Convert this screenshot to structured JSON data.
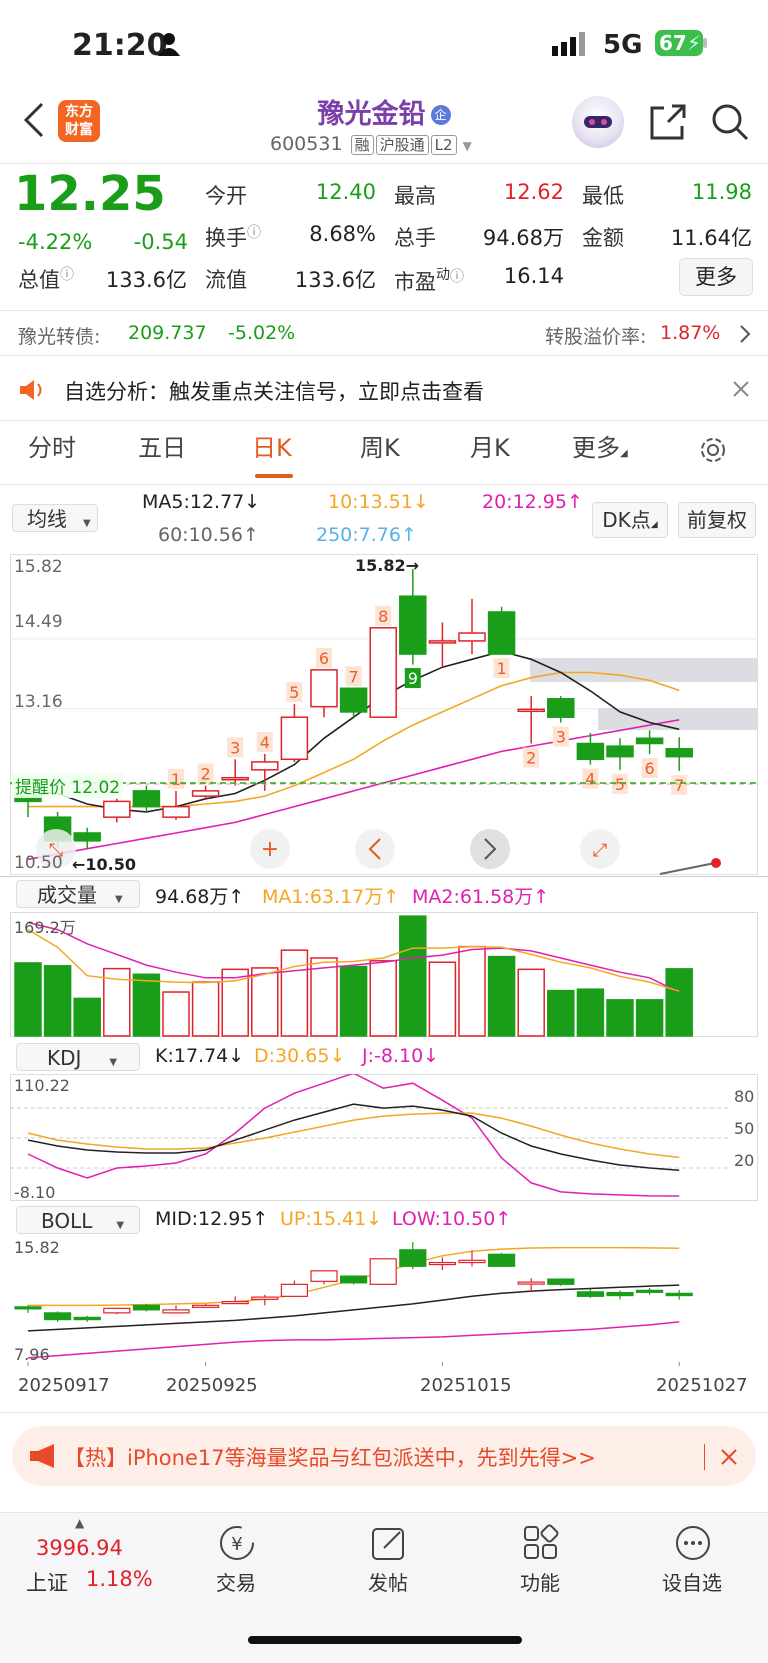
{
  "status": {
    "time": "21:20",
    "network": "5G",
    "battery": "67"
  },
  "header": {
    "back": "<",
    "logo_line1": "东方",
    "logo_line2": "财富",
    "title": "豫光金铅",
    "title_badge": "企",
    "code": "600531",
    "tags": [
      "融",
      "沪股通",
      "L2"
    ]
  },
  "quote": {
    "price": "12.25",
    "change_pct": "-4.22%",
    "change": "-0.54",
    "labels": {
      "open": "今开",
      "high": "最高",
      "low": "最低",
      "turnover": "换手",
      "volume": "总手",
      "amount": "金额",
      "mcap": "总值",
      "float": "流值",
      "pe": "市盈",
      "pe_sup": "动",
      "more": "更多"
    },
    "values": {
      "open": "12.40",
      "high": "12.62",
      "low": "11.98",
      "turnover": "8.68%",
      "volume": "94.68万",
      "amount": "11.64亿",
      "mcap": "133.6亿",
      "float": "133.6亿",
      "pe": "16.14"
    }
  },
  "bond": {
    "name": "豫光转债:",
    "price": "209.737",
    "change": "-5.02%",
    "premium_label": "转股溢价率:",
    "premium": "1.87%"
  },
  "notice": {
    "text": "自选分析：触发重点关注信号，立即点击查看"
  },
  "tabs": [
    "分时",
    "五日",
    "日K",
    "周K",
    "月K",
    "更多"
  ],
  "active_tab": "日K",
  "ma": {
    "selector": "均线",
    "ma5": "MA5:12.77",
    "ma10": "10:13.51",
    "ma20": "20:12.95",
    "ma60": "60:10.56",
    "ma250": "250:7.76",
    "dk": "DK点",
    "adjust": "前复权"
  },
  "kline": {
    "y_labels": [
      "15.82",
      "14.49",
      "13.16",
      "10.50"
    ],
    "high_label": "15.82",
    "low_label": "10.50",
    "alert_label": "提醒价 12.02",
    "nine_up": [
      "1",
      "2",
      "3",
      "4",
      "5",
      "6",
      "7",
      "8",
      "9"
    ],
    "nine_down": [
      "1",
      "2",
      "3",
      "4",
      "5",
      "6",
      "7"
    ]
  },
  "vol": {
    "selector": "成交量",
    "value": "94.68万",
    "ma1": "MA1:63.17万",
    "ma2": "MA2:61.58万",
    "y_top": "169.2万"
  },
  "kdj": {
    "selector": "KDJ",
    "k": "K:17.74",
    "d": "D:30.65",
    "j": "J:-8.10",
    "y_top": "110.22",
    "y_bottom": "-8.10",
    "levels": [
      "80",
      "50",
      "20"
    ]
  },
  "boll": {
    "selector": "BOLL",
    "mid": "MID:12.95",
    "up": "UP:15.41",
    "low": "LOW:10.50",
    "y_top": "15.82",
    "y_bottom": "7.96"
  },
  "dates": [
    "20250917",
    "20250925",
    "20251015",
    "20251027"
  ],
  "ad": {
    "text": "【热】iPhone17等海量奖品与红包派送中，先到先得>>"
  },
  "nav": {
    "index_value": "3996.94",
    "index_name": "上证",
    "index_change": "1.18%",
    "items": [
      "交易",
      "发帖",
      "功能",
      "设自选"
    ]
  },
  "colors": {
    "up": "#e0222a",
    "down": "#1a9e1a",
    "accent": "#e65a1e",
    "ma5": "#222222",
    "ma10": "#f5a623",
    "ma20": "#e020b0"
  },
  "chart_data": {
    "type": "candlestick",
    "candles": [
      {
        "o": 11.5,
        "c": 11.4,
        "h": 11.6,
        "l": 11.1
      },
      {
        "o": 11.1,
        "c": 10.65,
        "h": 11.2,
        "l": 10.5
      },
      {
        "o": 10.8,
        "c": 10.65,
        "h": 10.9,
        "l": 10.5
      },
      {
        "o": 11.1,
        "c": 11.4,
        "h": 11.45,
        "l": 11.0
      },
      {
        "o": 11.6,
        "c": 11.3,
        "h": 11.7,
        "l": 11.2
      },
      {
        "o": 11.1,
        "c": 11.3,
        "h": 11.6,
        "l": 11.05
      },
      {
        "o": 11.5,
        "c": 11.6,
        "h": 11.7,
        "l": 11.45
      },
      {
        "o": 11.85,
        "c": 11.85,
        "h": 12.2,
        "l": 11.7
      },
      {
        "o": 12.0,
        "c": 12.15,
        "h": 12.3,
        "l": 11.6
      },
      {
        "o": 12.2,
        "c": 13.0,
        "h": 13.25,
        "l": 12.15
      },
      {
        "o": 13.2,
        "c": 13.9,
        "h": 13.9,
        "l": 13.0
      },
      {
        "o": 13.55,
        "c": 13.1,
        "h": 13.55,
        "l": 13.0
      },
      {
        "o": 13.0,
        "c": 14.7,
        "h": 14.7,
        "l": 13.0
      },
      {
        "o": 15.3,
        "c": 14.2,
        "h": 15.82,
        "l": 14.0
      },
      {
        "o": 14.45,
        "c": 14.45,
        "h": 14.8,
        "l": 13.95
      },
      {
        "o": 14.45,
        "c": 14.6,
        "h": 15.25,
        "l": 14.2
      },
      {
        "o": 15.0,
        "c": 14.2,
        "h": 15.1,
        "l": 14.2
      },
      {
        "o": 13.15,
        "c": 13.15,
        "h": 13.4,
        "l": 12.5
      },
      {
        "o": 13.35,
        "c": 13.0,
        "h": 13.4,
        "l": 12.9
      },
      {
        "o": 12.5,
        "c": 12.2,
        "h": 12.7,
        "l": 12.1
      },
      {
        "o": 12.45,
        "c": 12.25,
        "h": 12.6,
        "l": 12.0
      },
      {
        "o": 12.6,
        "c": 12.5,
        "h": 12.75,
        "l": 12.3
      },
      {
        "o": 12.4,
        "c": 12.25,
        "h": 12.62,
        "l": 11.98
      }
    ],
    "ma5": [
      11.6,
      11.55,
      11.35,
      11.25,
      11.2,
      11.3,
      11.45,
      11.55,
      11.8,
      12.1,
      12.6,
      13.0,
      13.4,
      13.7,
      13.95,
      14.1,
      14.25,
      14.1,
      13.85,
      13.5,
      13.1,
      12.9,
      12.77
    ],
    "ma10": [
      11.3,
      11.3,
      11.3,
      11.3,
      11.3,
      11.3,
      11.35,
      11.4,
      11.5,
      11.7,
      11.95,
      12.2,
      12.55,
      12.85,
      13.1,
      13.35,
      13.6,
      13.75,
      13.85,
      13.85,
      13.8,
      13.7,
      13.51
    ],
    "ma20": [
      10.3,
      10.4,
      10.5,
      10.6,
      10.7,
      10.8,
      10.9,
      11.0,
      11.15,
      11.3,
      11.45,
      11.6,
      11.75,
      11.9,
      12.05,
      12.2,
      12.35,
      12.45,
      12.55,
      12.65,
      12.75,
      12.85,
      12.95
    ],
    "volume_wan": [
      103,
      99,
      53,
      95,
      87,
      62,
      76,
      94,
      96,
      121,
      110,
      98,
      106,
      169,
      104,
      126,
      112,
      94,
      64,
      66,
      51,
      51,
      94.68
    ],
    "vol_ma1": [
      150,
      125,
      85,
      80,
      78,
      76,
      75,
      78,
      87,
      98,
      104,
      105,
      110,
      124,
      124,
      126,
      125,
      115,
      104,
      96,
      84,
      76,
      63.17
    ],
    "vol_ma2": [
      160,
      150,
      130,
      115,
      100,
      90,
      82,
      82,
      88,
      92,
      96,
      100,
      104,
      110,
      114,
      122,
      124,
      120,
      110,
      100,
      90,
      82,
      61.58
    ],
    "kdj_k": [
      48,
      42,
      38,
      36,
      35,
      35,
      38,
      48,
      58,
      68,
      76,
      84,
      80,
      82,
      78,
      72,
      55,
      42,
      34,
      28,
      23,
      20,
      17.74
    ],
    "kdj_d": [
      55,
      48,
      44,
      41,
      39,
      39,
      40,
      45,
      50,
      56,
      62,
      68,
      72,
      74,
      75,
      75,
      70,
      62,
      53,
      45,
      39,
      34,
      30.65
    ],
    "kdj_j": [
      34,
      20,
      10,
      20,
      22,
      25,
      34,
      55,
      80,
      95,
      105,
      115,
      100,
      105,
      88,
      70,
      30,
      5,
      -4,
      -6,
      -7,
      -8,
      -8.1
    ]
  }
}
